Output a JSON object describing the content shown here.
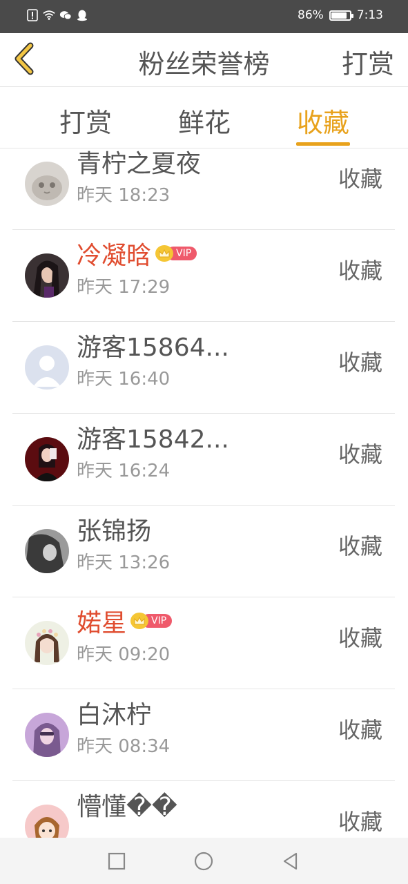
{
  "status_bar": {
    "battery": "86%",
    "battery_level": 0.86,
    "time": "7:13",
    "icons": [
      "alert-icon",
      "wifi-icon",
      "wechat-icon",
      "qq-icon"
    ]
  },
  "header": {
    "title": "粉丝荣誉榜",
    "right_action": "打赏",
    "back_icon": "chevron-left-icon"
  },
  "tabs": [
    {
      "label": "打赏",
      "active": false
    },
    {
      "label": "鲜花",
      "active": false
    },
    {
      "label": "收藏",
      "active": true
    }
  ],
  "colors": {
    "accent": "#e8a21c",
    "vip_name": "#e04c2f",
    "vip_badge": "#ef5a6b",
    "crown": "#f5c634"
  },
  "entries": [
    {
      "name": "青柠之夏夜",
      "vip": false,
      "time": "昨天 18:23",
      "action": "收藏",
      "avatar": "cat-avatar"
    },
    {
      "name": "冷凝晗",
      "vip": true,
      "vip_label": "VIP",
      "time": "昨天 17:29",
      "action": "收藏",
      "avatar": "girl-dark-hair-avatar"
    },
    {
      "name": "游客15864...",
      "vip": false,
      "time": "昨天 16:40",
      "action": "收藏",
      "avatar": "default-user-avatar"
    },
    {
      "name": "游客15842...",
      "vip": false,
      "time": "昨天 16:24",
      "action": "收藏",
      "avatar": "girl-red-background-avatar"
    },
    {
      "name": "张锦扬",
      "vip": false,
      "time": "昨天 13:26",
      "action": "收藏",
      "avatar": "grayscale-portrait-avatar"
    },
    {
      "name": "婼星",
      "vip": true,
      "vip_label": "VIP",
      "time": "昨天 09:20",
      "action": "收藏",
      "avatar": "girl-flower-crown-avatar"
    },
    {
      "name": "白沐柠",
      "vip": false,
      "time": "昨天 08:34",
      "action": "收藏",
      "avatar": "girl-purple-tone-avatar"
    },
    {
      "name": "懵懂��",
      "vip": false,
      "time": "",
      "action": "收藏",
      "avatar": "cartoon-girl-avatar"
    }
  ],
  "nav_bar": [
    "recent-apps-icon",
    "home-icon",
    "back-icon"
  ]
}
